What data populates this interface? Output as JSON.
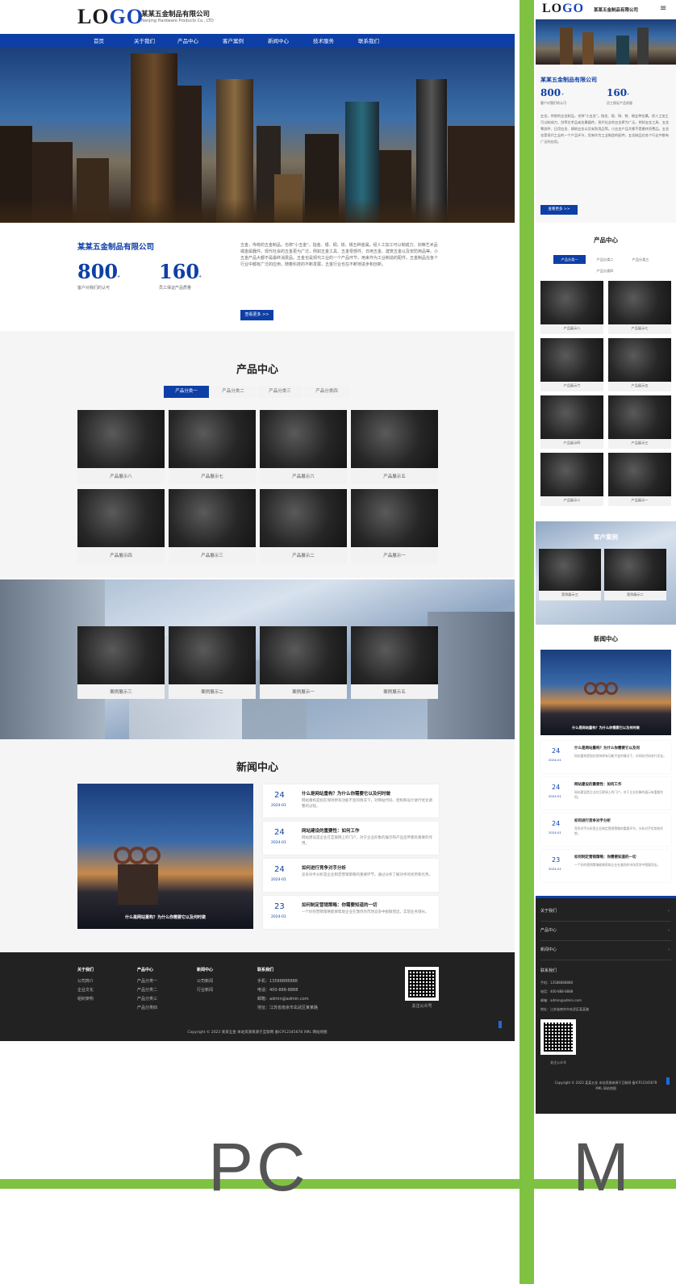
{
  "pc": {
    "logo": {
      "text": "LO",
      "accent": "GO"
    },
    "company": "某某五金制品有限公司",
    "company_en": "Nanjing Hardware Products Co., LTD",
    "nav": [
      "首页",
      "关于我们",
      "产品中心",
      "客户案例",
      "新闻中心",
      "技术服务",
      "联系我们"
    ],
    "about": {
      "title": "某某五金制品有限公司",
      "stat1_value": "800",
      "stat1_unit": "+",
      "stat1_label": "客户对我们的认可",
      "stat2_value": "160",
      "stat2_unit": "+",
      "stat2_label": "员工保证产品质量",
      "paragraph": "五金，传统的五金制品，也称\"小五金\"。指金、银、铜、铁、锡五种金属。经人工加工可以制成刀、剑等艺术品或金属器件。现代社会的五金更为广泛，例如五金工具、五金零部件、日用五金、建筑五金以及安防用品等。小五金产品大都不是最终消费品。五金也是现代工业的一个产品环节，用来作为工业制造的配件。五金制品在各个行业中都有广泛的应用，随着科技的不断发展，五金行业也在不断地进步和创新。",
      "button": "查看更多 >>"
    },
    "products": {
      "title": "产品中心",
      "tabs": [
        "产品分类一",
        "产品分类二",
        "产品分类三",
        "产品分类四"
      ],
      "items": [
        "产品展示八",
        "产品展示七",
        "产品展示六",
        "产品展示五",
        "产品展示四",
        "产品展示三",
        "产品展示二",
        "产品展示一"
      ]
    },
    "cases": {
      "items": [
        "案例展示三",
        "案例展示二",
        "案例展示一",
        "案例展示五"
      ]
    },
    "news": {
      "title": "新闻中心",
      "feature_caption": "什么是网站重构？为什么你需要它以及何时做",
      "items": [
        {
          "day": "24",
          "ym": "2024-01",
          "title": "什么是网站重构？为什么你需要它以及何时做",
          "desc": "网站重构是指在保持原有功能不变的情况下，对网站代码、结构和设计进行优化调整的过程。"
        },
        {
          "day": "24",
          "ym": "2024-01",
          "title": "网站建设的重要性：如何工作",
          "desc": "网站建设是企业在互联网上的门户，对于企业形象的展示和产品宣传都有重要的作用。"
        },
        {
          "day": "24",
          "ym": "2024-01",
          "title": "如何进行竞争对手分析",
          "desc": "竞争对手分析是企业制定营销策略的重要环节，通过分析了解对手的优势和劣势。"
        },
        {
          "day": "23",
          "ym": "2024-01",
          "title": "如何制定营销策略：你需要知道的一切",
          "desc": "一个好的营销策略能够帮助企业在激烈的市场竞争中脱颖而出，实现业务增长。"
        }
      ]
    },
    "footer": {
      "cols": [
        {
          "title": "关于我们",
          "links": [
            "公司简介",
            "企业文化",
            "组织架构"
          ]
        },
        {
          "title": "产品中心",
          "links": [
            "产品分类一",
            "产品分类二",
            "产品分类三",
            "产品分类四"
          ]
        },
        {
          "title": "新闻中心",
          "links": [
            "公司新闻",
            "行业新闻"
          ]
        },
        {
          "title": "联系我们",
          "links": [
            "手机：13588888888",
            "电话：400-888-8888",
            "邮箱：admin@admin.com",
            "地址：江苏省南京市玄武区某某路"
          ]
        }
      ],
      "qr_label": "关注公众号",
      "copyright": "Copyright © 2023 某某五金 本站资源来源于互联网 备ICP12345678 XML 网站地图"
    }
  },
  "m": {
    "logo": {
      "text": "LO",
      "accent": "GO"
    },
    "company": "某某五金制品有限公司",
    "about_title": "某某五金制品有限公司",
    "stat1_value": "800",
    "stat1_unit": "+",
    "stat1_label": "客户对我们的认可",
    "stat2_value": "160",
    "stat2_unit": "+",
    "stat2_label": "员工保证产品质量",
    "paragraph": "五金，传统的五金制品，也称\"小五金\"。指金、银、铜、铁、锡五种金属。经人工加工可以制成刀、剑等艺术品或金属器件。现代社会的五金更为广泛，例如五金工具、五金零部件、日用五金、建筑五金以及安防用品等。小五金产品大都不是最终消费品。五金也是现代工业的一个产品环节，用来作为工业制造的配件。五金制品在各个行业中都有广泛的应用。",
    "button": "查看更多 >>",
    "products_title": "产品中心",
    "tabs": [
      "产品分类一",
      "产品分类二",
      "产品分类三",
      "产品分类四"
    ],
    "products": [
      "产品展示八",
      "产品展示七",
      "产品展示六",
      "产品展示五",
      "产品展示四",
      "产品展示三",
      "产品展示二",
      "产品展示一"
    ],
    "cases_title": "客户案例",
    "cases": [
      "案例展示三",
      "案例展示二"
    ],
    "news_title": "新闻中心",
    "news_feature": "什么是网站重构？为什么你需要它以及何时做",
    "news": [
      {
        "day": "24",
        "ym": "2024-01",
        "title": "什么是网站重构？为什么你需要它以及何",
        "desc": "网站重构是指在保持原有功能不变的情况下，对网站代码进行优化。"
      },
      {
        "day": "24",
        "ym": "2024-01",
        "title": "网站建设的重要性：如何工作",
        "desc": "网站建设是企业在互联网上的门户，对于企业形象的展示有重要作用。"
      },
      {
        "day": "24",
        "ym": "2024-01",
        "title": "如何进行竞争对手分析",
        "desc": "竞争对手分析是企业制定营销策略的重要环节，分析对手优势和劣势。"
      },
      {
        "day": "23",
        "ym": "2024-01",
        "title": "如何制定营销策略：你需要知道的一切",
        "desc": "一个好的营销策略能够帮助企业在激烈的市场竞争中脱颖而出。"
      }
    ],
    "footer_menu": [
      "关于我们",
      "产品中心",
      "新闻中心"
    ],
    "contact_title": "联系我们",
    "contact": [
      "手机：13588888888",
      "电话：400-888-8888",
      "邮箱：admin@admin.com",
      "地址：江苏省南京市玄武区某某路"
    ],
    "qr_label": "关注公众号",
    "copyright": "Copyright © 2023 某某五金 本站资源来源于互联网 备ICP12345678 XML 网站地图"
  },
  "labels": {
    "pc": "PC",
    "m": "M"
  }
}
